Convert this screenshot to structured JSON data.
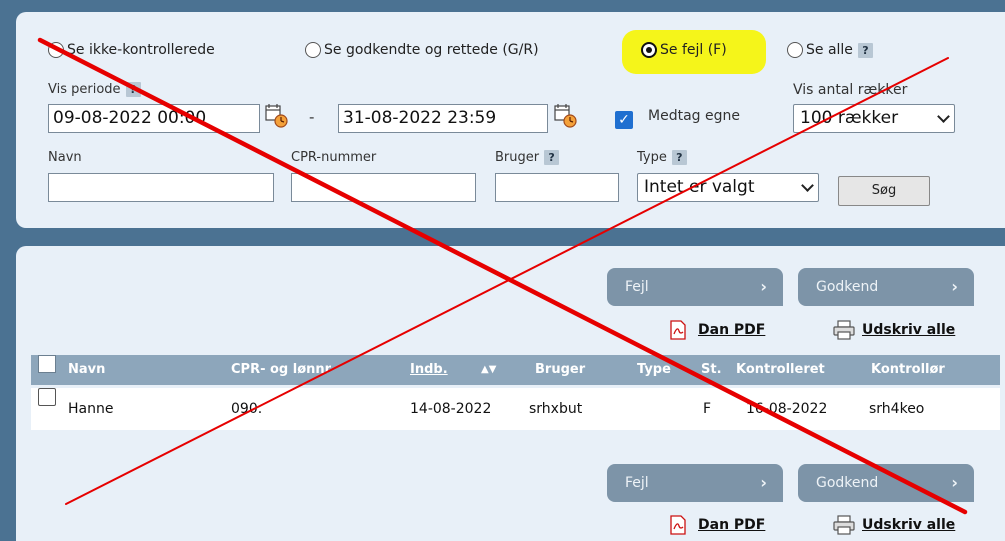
{
  "filters": {
    "radios": [
      {
        "label": "Se ikke-kontrollerede",
        "checked": false
      },
      {
        "label": "Se godkendte og rettede (G/R)",
        "checked": false
      },
      {
        "label": "Se fejl (F)",
        "checked": true
      },
      {
        "label": "Se alle",
        "checked": false
      }
    ],
    "help": "?",
    "period_label": "Vis periode",
    "date_from": "09-08-2022 00:00",
    "date_sep": "-",
    "date_to": "31-08-2022 23:59",
    "include_own_label": "Medtag egne",
    "include_own_checked": true,
    "rows_label": "Vis antal rækker",
    "rows_value": "100 rækker",
    "name_label": "Navn",
    "cpr_label": "CPR-nummer",
    "user_label": "Bruger",
    "type_label": "Type",
    "type_value": "Intet er valgt",
    "search_label": "Søg"
  },
  "actions": {
    "fejl_label": "Fejl",
    "godkend_label": "Godkend",
    "pdf_label": "Dan PDF",
    "print_label": "Udskriv alle"
  },
  "table": {
    "columns": [
      "Navn",
      "CPR- og lønnr",
      "Indb.",
      "Bruger",
      "Type",
      "St.",
      "Kontrolleret",
      "Kontrollør"
    ],
    "rows": [
      {
        "navn": "Hanne",
        "cpr": "090.",
        "indb": "14-08-2022",
        "bruger": "srhxbut",
        "type": "",
        "st": "F",
        "kontrolleret": "16-08-2022",
        "kontrollor": "srh4keo"
      }
    ]
  },
  "colors": {
    "accent": "#1f6fd0",
    "highlight": "#f5f51a",
    "annotation": "#e60000"
  }
}
